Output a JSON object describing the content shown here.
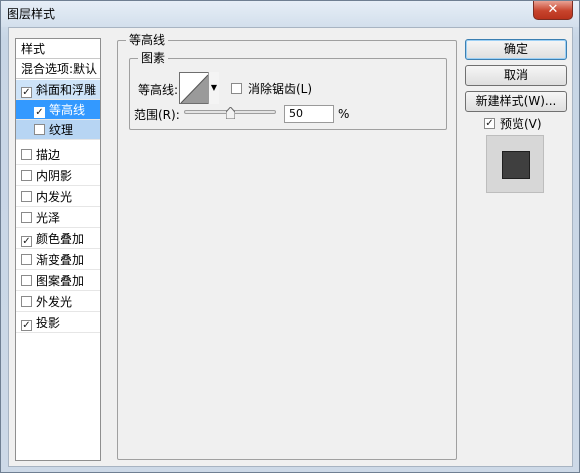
{
  "window": {
    "title": "图层样式",
    "close_glyph": "✕"
  },
  "styles_list": {
    "header": "样式",
    "blend_options": "混合选项:默认",
    "items": [
      {
        "label": "斜面和浮雕",
        "checked": true
      },
      {
        "label": "等高线",
        "checked": true
      },
      {
        "label": "纹理",
        "checked": false
      },
      {
        "label": "描边",
        "checked": false
      },
      {
        "label": "内阴影",
        "checked": false
      },
      {
        "label": "内发光",
        "checked": false
      },
      {
        "label": "光泽",
        "checked": false
      },
      {
        "label": "颜色叠加",
        "checked": true
      },
      {
        "label": "渐变叠加",
        "checked": false
      },
      {
        "label": "图案叠加",
        "checked": false
      },
      {
        "label": "外发光",
        "checked": false
      },
      {
        "label": "投影",
        "checked": true
      }
    ]
  },
  "contour_panel": {
    "group_title": "等高线",
    "subgroup_title": "图素",
    "contour_label": "等高线:",
    "antialias_label": "消除锯齿(L)",
    "antialias_checked": false,
    "range_label": "范围(R):",
    "range_value": "50",
    "range_percent": 0.5,
    "range_unit": "%"
  },
  "buttons": {
    "ok": "确定",
    "cancel": "取消",
    "new_style": "新建样式(W)..."
  },
  "preview": {
    "label": "预览(V)",
    "checked": true
  },
  "colors": {
    "accent": "#3399ff",
    "swatch": "#3f3f3f"
  }
}
